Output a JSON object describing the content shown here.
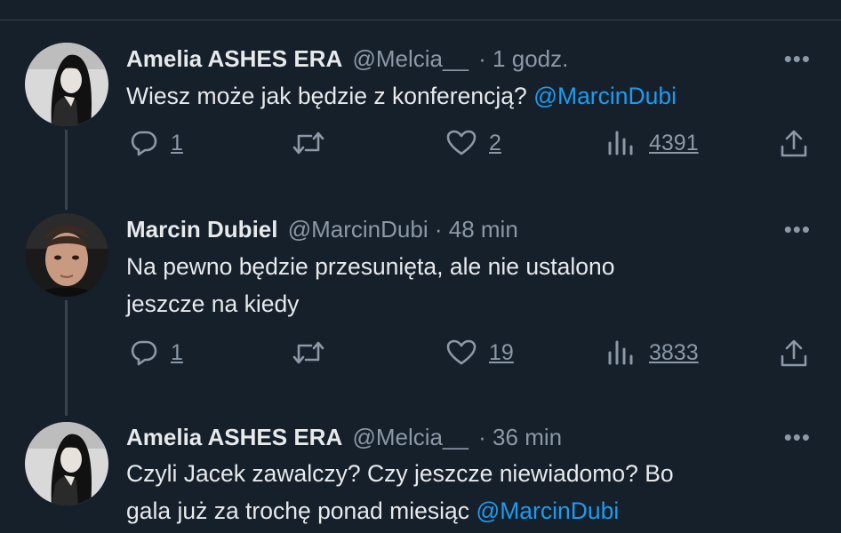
{
  "tweets": [
    {
      "name": "Amelia ASHES ERA",
      "handle": "@Melcia__",
      "separator": "·",
      "time": "1 godz.",
      "more": "•••",
      "text_lines": [
        "Wiesz może jak będzie z konferencją?"
      ],
      "mention": "@MarcinDubi",
      "replies": "1",
      "likes": "2",
      "views": "4391"
    },
    {
      "name": "Marcin Dubiel",
      "handle": "@MarcinDubi",
      "separator": "·",
      "time": "48 min",
      "more": "•••",
      "text_lines": [
        "Na pewno będzie przesunięta, ale nie ustalono",
        "jeszcze na kiedy"
      ],
      "replies": "1",
      "likes": "19",
      "views": "3833"
    },
    {
      "name": "Amelia ASHES ERA",
      "handle": "@Melcia__",
      "separator": "·",
      "time": "36 min",
      "more": "•••",
      "text_lines": [
        "Czyli Jacek zawalczy? Czy jeszcze niewiadomo? Bo",
        "gala już za trochę ponad miesiąc"
      ],
      "mention": "@MarcinDubi"
    }
  ],
  "icons": {
    "reply": "reply-icon",
    "retweet": "retweet-icon",
    "like": "heart-icon",
    "views": "views-icon",
    "share": "share-icon",
    "more": "more-icon"
  },
  "colors": {
    "background": "#15202b",
    "mention": "#1d9bf0",
    "secondary": "#8b98a5"
  }
}
